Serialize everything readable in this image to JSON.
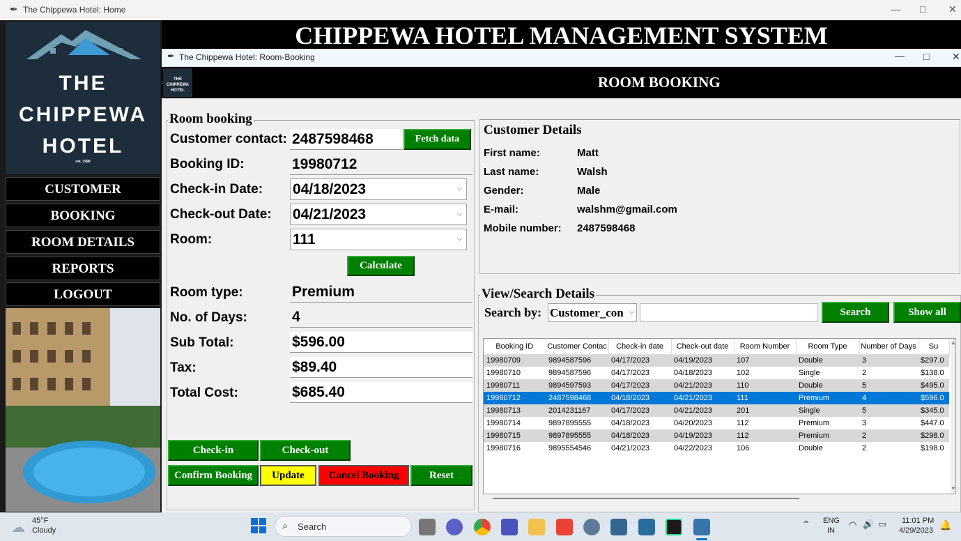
{
  "main_window": {
    "title": "The Chippewa Hotel: Home",
    "banner": "CHIPPEWA HOTEL MANAGEMENT SYSTEM"
  },
  "logo": {
    "line1": "THE",
    "line2": "CHIPPEWA",
    "line3": "HOTEL",
    "est": "est. 1998"
  },
  "sidebar_menu": [
    "CUSTOMER",
    "BOOKING",
    "ROOM DETAILS",
    "REPORTS",
    "LOGOUT"
  ],
  "booking_window": {
    "title": "The Chippewa Hotel: Room-Booking",
    "heading": "ROOM BOOKING",
    "mini_logo": [
      "THE",
      "CHIPPEWA",
      "HOTEL"
    ]
  },
  "room_booking": {
    "frame_title": "Room booking",
    "customer_contact_label": "Customer contact:",
    "customer_contact": "2487598468",
    "fetch_btn": "Fetch data",
    "booking_id_label": "Booking ID:",
    "booking_id": "19980712",
    "checkin_label": "Check-in Date:",
    "checkin": "04/18/2023",
    "checkout_label": "Check-out Date:",
    "checkout": "04/21/2023",
    "room_label": "Room:",
    "room": "111",
    "calculate_btn": "Calculate",
    "room_type_label": "Room type:",
    "room_type": "Premium",
    "days_label": "No. of Days:",
    "days": "4",
    "subtotal_label": "Sub Total:",
    "subtotal": "$596.00",
    "tax_label": "Tax:",
    "tax": "$89.40",
    "total_label": "Total Cost:",
    "total": "$685.40",
    "buttons": {
      "checkin": "Check-in",
      "checkout": "Check-out",
      "confirm": "Confirm Booking",
      "update": "Update",
      "cancel": "Cancel Booking",
      "reset": "Reset"
    }
  },
  "customer_details": {
    "frame_title": "Customer Details",
    "labels": [
      "First name:",
      "Last name:",
      "Gender:",
      "E-mail:",
      "Mobile number:"
    ],
    "values": [
      "Matt",
      "Walsh",
      "Male",
      "walshm@gmail.com",
      "2487598468"
    ]
  },
  "search": {
    "frame_title": "View/Search Details",
    "search_by_label": "Search by:",
    "search_by_value": "Customer_con",
    "search_btn": "Search",
    "show_all_btn": "Show all"
  },
  "table": {
    "headers": [
      "Booking ID",
      "Customer Contac",
      "Check-in date",
      "Check-out date",
      "Room Number",
      "Room Type",
      "Number of Days",
      "Su"
    ],
    "rows": [
      [
        "19980709",
        "9894587596",
        "04/17/2023",
        "04/19/2023",
        "107",
        "Double",
        "3",
        "$297.0"
      ],
      [
        "19980710",
        "9894587596",
        "04/17/2023",
        "04/18/2023",
        "102",
        "Single",
        "2",
        "$138.0"
      ],
      [
        "19980711",
        "9894597593",
        "04/17/2023",
        "04/21/2023",
        "110",
        "Double",
        "5",
        "$495.0"
      ],
      [
        "19980712",
        "2487598468",
        "04/18/2023",
        "04/21/2023",
        "111",
        "Premium",
        "4",
        "$596.0"
      ],
      [
        "19980713",
        "2014231167",
        "04/17/2023",
        "04/21/2023",
        "201",
        "Single",
        "5",
        "$345.0"
      ],
      [
        "19980714",
        "9897895555",
        "04/18/2023",
        "04/20/2023",
        "112",
        "Premium",
        "3",
        "$447.0"
      ],
      [
        "19980715",
        "9897895555",
        "04/18/2023",
        "04/19/2023",
        "112",
        "Premium",
        "2",
        "$298.0"
      ],
      [
        "19980716",
        "9895554546",
        "04/21/2023",
        "04/22/2023",
        "106",
        "Double",
        "2",
        "$198.0"
      ]
    ],
    "selected_row": 3
  },
  "taskbar": {
    "weather_temp": "45°F",
    "weather_desc": "Cloudy",
    "search_placeholder": "Search",
    "lang1": "ENG",
    "lang2": "IN",
    "time": "11:01 PM",
    "date": "4/29/2023"
  }
}
